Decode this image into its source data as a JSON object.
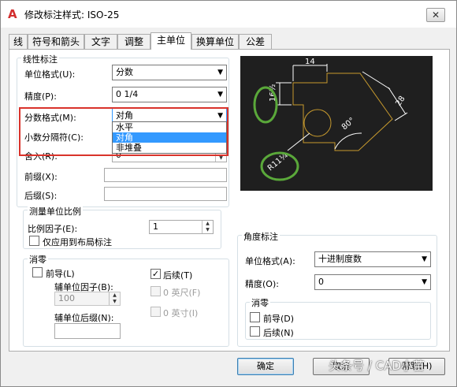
{
  "window": {
    "title": "修改标注样式: ISO-25",
    "app_icon": "A",
    "close_glyph": "✕"
  },
  "tabs": [
    {
      "label": "线"
    },
    {
      "label": "符号和箭头"
    },
    {
      "label": "文字"
    },
    {
      "label": "调整"
    },
    {
      "label": "主单位"
    },
    {
      "label": "换算单位"
    },
    {
      "label": "公差"
    }
  ],
  "linear": {
    "group_title": "线性标注",
    "unit_format_label": "单位格式(U):",
    "unit_format_value": "分数",
    "precision_label": "精度(P):",
    "precision_value": "0 1/4",
    "fraction_format_label": "分数格式(M):",
    "fraction_format_value": "对角",
    "fraction_options": [
      "水平",
      "对角",
      "非堆叠"
    ],
    "decimal_sep_label": "小数分隔符(C):",
    "round_label": "舍入(R):",
    "round_value": "0",
    "prefix_label": "前缀(X):",
    "suffix_label": "后缀(S):"
  },
  "measure_scale": {
    "group_title": "测量单位比例",
    "factor_label": "比例因子(E):",
    "factor_value": "1",
    "layout_only_label": "仅应用到布局标注"
  },
  "zero_suppress_linear": {
    "group_title": "消零",
    "leading_label": "前导(L)",
    "leading_checked": false,
    "trailing_label": "后续(T)",
    "trailing_checked": true,
    "sub_factor_label": "辅单位因子(B):",
    "sub_factor_value": "100",
    "sub_suffix_label": "辅单位后缀(N):",
    "feet_label": "0 英尺(F)",
    "inches_label": "0 英寸(I)"
  },
  "angular": {
    "group_title": "角度标注",
    "unit_format_label": "单位格式(A):",
    "unit_format_value": "十进制度数",
    "precision_label": "精度(O):",
    "precision_value": "0",
    "zero_title": "消零",
    "leading_label": "前导(D)",
    "trailing_label": "后续(N)"
  },
  "preview": {
    "dim_top": "14",
    "dim_left": "16½",
    "dim_right": "28",
    "dim_angle": "80°",
    "dim_radius": "R11¼",
    "colors": {
      "bg": "#1f1f1f",
      "geometry": "#c79a2e",
      "dims": "#ffffff",
      "highlight": "#5aa83a"
    }
  },
  "buttons": {
    "ok": "确定",
    "cancel": "取消",
    "help": "帮助(H)"
  },
  "watermark": "头条号 / CAD小苗",
  "highlight_color": "#d9332b"
}
